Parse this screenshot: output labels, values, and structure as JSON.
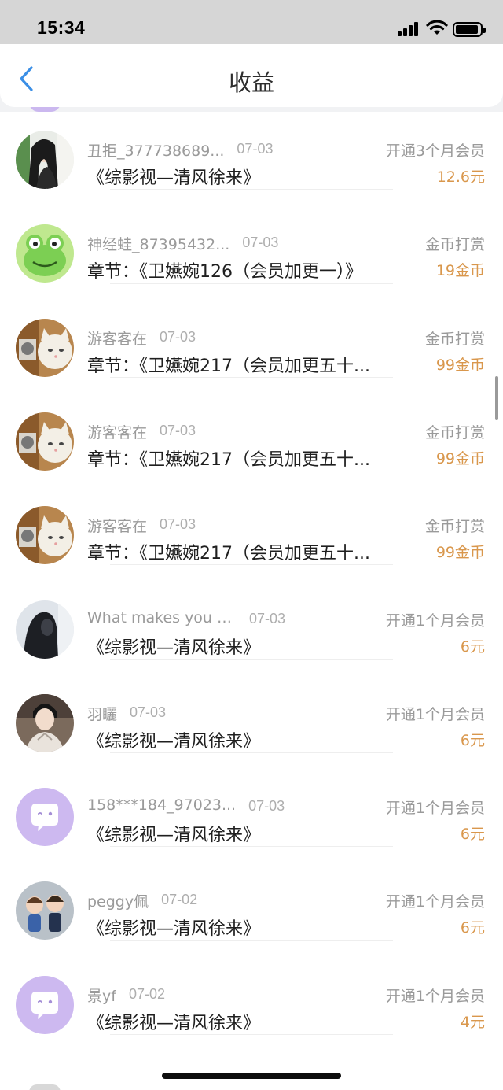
{
  "status_bar": {
    "time": "15:34",
    "icons": [
      "signal-icon",
      "wifi-icon",
      "battery-icon"
    ]
  },
  "header": {
    "back_icon": "chevron-left-icon",
    "title": "收益"
  },
  "colors": {
    "accent_back": "#3b8fe6",
    "amount": "#d9974c",
    "secondary_text": "#9a9a9a",
    "primary_text": "#1f1f1f"
  },
  "earnings": [
    {
      "name": "丑拒_377738689...",
      "date": "07-03",
      "book": "《综影视—清风徐来》",
      "type": "开通3个月会员",
      "amount": "12.6元",
      "avatar": "photo-avatar-girl"
    },
    {
      "name": "神经蛙_87395432...",
      "date": "07-03",
      "book": "章节：《卫嬿婉126（会员加更一）》",
      "type": "金币打赏",
      "amount": "19金币",
      "avatar": "frog-avatar"
    },
    {
      "name": "游客客在",
      "date": "07-03",
      "book": "章节：《卫嬿婉217（会员加更五十...",
      "type": "金币打赏",
      "amount": "99金币",
      "avatar": "cat-avatar"
    },
    {
      "name": "游客客在",
      "date": "07-03",
      "book": "章节：《卫嬿婉217（会员加更五十...",
      "type": "金币打赏",
      "amount": "99金币",
      "avatar": "cat-avatar"
    },
    {
      "name": "游客客在",
      "date": "07-03",
      "book": "章节：《卫嬿婉217（会员加更五十...",
      "type": "金币打赏",
      "amount": "99金币",
      "avatar": "cat-avatar"
    },
    {
      "name": "What makes you b...",
      "date": "07-03",
      "book": "《综影视—清风徐来》",
      "type": "开通1个月会员",
      "amount": "6元",
      "avatar": "dark-photo-avatar"
    },
    {
      "name": "羽矖",
      "date": "07-03",
      "book": "《综影视—清风徐来》",
      "type": "开通1个月会员",
      "amount": "6元",
      "avatar": "costume-photo-avatar"
    },
    {
      "name": "158***184_97023...",
      "date": "07-03",
      "book": "《综影视—清风徐来》",
      "type": "开通1个月会员",
      "amount": "6元",
      "avatar": "default-chat-avatar"
    },
    {
      "name": "peggy佩",
      "date": "07-02",
      "book": "《综影视—清风徐来》",
      "type": "开通1个月会员",
      "amount": "6元",
      "avatar": "cartoon-couple-avatar"
    },
    {
      "name": "景yf",
      "date": "07-02",
      "book": "《综影视—清风徐来》",
      "type": "开通1个月会员",
      "amount": "4元",
      "avatar": "default-chat-avatar"
    }
  ]
}
